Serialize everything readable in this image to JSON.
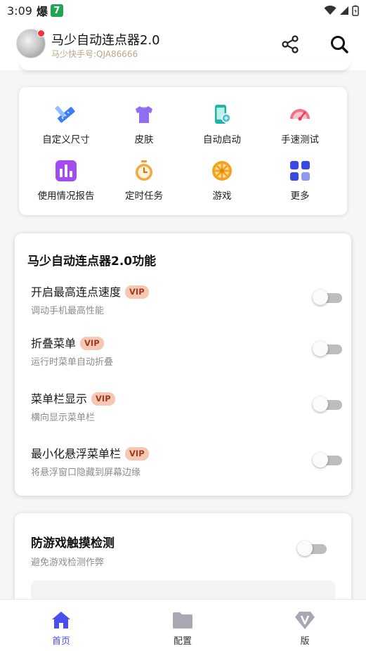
{
  "status_bar": {
    "time": "3:09",
    "app_badge": "爆",
    "seven_badge": "7"
  },
  "header": {
    "title": "马少自动连点器2.0",
    "subtitle": "马少快手号:QJA86666"
  },
  "quick_grid": {
    "items": [
      {
        "label": "自定义尺寸",
        "icon": "ruler-pencil-icon"
      },
      {
        "label": "皮肤",
        "icon": "tshirt-icon"
      },
      {
        "label": "自动启动",
        "icon": "phone-link-icon"
      },
      {
        "label": "手速测试",
        "icon": "speedometer-icon"
      },
      {
        "label": "使用情况报告",
        "icon": "bar-chart-icon"
      },
      {
        "label": "定时任务",
        "icon": "stopwatch-icon"
      },
      {
        "label": "游戏",
        "icon": "wheel-icon"
      },
      {
        "label": "更多",
        "icon": "grid-more-icon"
      }
    ]
  },
  "features": {
    "title": "马少自动连点器2.0功能",
    "vip_label": "VIP",
    "rows": [
      {
        "name": "开启最高连点速度",
        "desc": "调动手机最高性能",
        "vip": true,
        "enabled": false
      },
      {
        "name": "折叠菜单",
        "desc": "运行时菜单自动折叠",
        "vip": true,
        "enabled": false
      },
      {
        "name": "菜单栏显示",
        "desc": "横向显示菜单栏",
        "vip": true,
        "enabled": false
      },
      {
        "name": "最小化悬浮菜单栏",
        "desc": "将悬浮窗口隐藏到屏幕边缘",
        "vip": true,
        "enabled": false
      }
    ]
  },
  "anti_detect": {
    "title": "防游戏触摸检测",
    "desc": "避免游戏检测作弊",
    "enabled": false
  },
  "bottom_nav": {
    "items": [
      {
        "label": "首页",
        "icon": "home-icon",
        "active": true
      },
      {
        "label": "配置",
        "icon": "folder-icon",
        "active": false
      },
      {
        "label": "版",
        "icon": "vip-diamond-icon",
        "active": false
      }
    ]
  },
  "colors": {
    "accent": "#4a4ef0",
    "vip_bg": "#f6c8b4",
    "vip_text": "#9c3d20",
    "notification_dot": "#f5313c"
  }
}
